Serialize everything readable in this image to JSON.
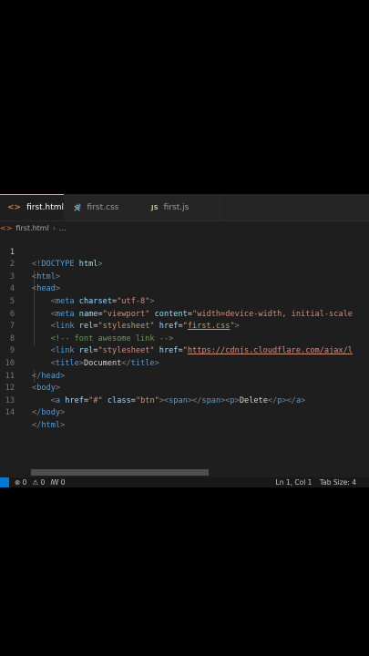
{
  "tabs": [
    {
      "icon": "<>",
      "label": "first.html",
      "active": true
    },
    {
      "icon": "#",
      "label": "first.css",
      "active": false
    },
    {
      "icon": "JS",
      "label": "first.js",
      "active": false
    }
  ],
  "breadcrumb": {
    "file": "first.html",
    "more": "..."
  },
  "line_numbers": [
    "1",
    "2",
    "3",
    "4",
    "5",
    "6",
    "7",
    "8",
    "9",
    "10",
    "11",
    "12",
    "13",
    "14"
  ],
  "code": {
    "l1_open": "<!",
    "l1_tag": "DOCTYPE",
    "l1_attr": "html",
    "l1_close": ">",
    "l2_tag": "html",
    "l3_tag": "head",
    "l4_tag": "meta",
    "l4_attr": "charset",
    "l4_val": "\"utf-8\"",
    "l5_tag": "meta",
    "l5_attr1": "name",
    "l5_val1": "\"viewport\"",
    "l5_attr2": "content",
    "l5_val2": "\"width=device-width, initial-scale",
    "l6_tag": "link",
    "l6_attr1": "rel",
    "l6_val1": "\"stylesheet\"",
    "l6_attr2": "href",
    "l6_val2a": "\"",
    "l6_val2b": "first.css",
    "l6_val2c": "\"",
    "l7_comment": "<!-- font awesome link -->",
    "l8_tag": "link",
    "l8_attr1": "rel",
    "l8_val1": "\"stylesheet\"",
    "l8_attr2": "href",
    "l8_val2a": "\"",
    "l8_val2b": "https://cdnjs.cloudflare.com/ajax/l",
    "l9_tag": "title",
    "l9_text": "Document",
    "l10_tag": "head",
    "l11_tag": "body",
    "l12_tag": "a",
    "l12_attr1": "href",
    "l12_val1": "\"#\"",
    "l12_attr2": "class",
    "l12_val2": "\"btn\"",
    "l12_span": "span",
    "l12_p": "p",
    "l12_text": "Delete",
    "l13_tag": "body",
    "l14_tag": "html"
  },
  "status": {
    "errors": "⊗ 0",
    "warnings": "⚠ 0",
    "ports": "ꟿ 0",
    "position": "Ln 1, Col 1",
    "tabsize": "Tab Size: 4"
  },
  "colors": {
    "tag": "#569cd6",
    "attr": "#9cdcfe",
    "string": "#ce9178",
    "comment": "#6a9955",
    "active_tab_border": "#e8ab53"
  }
}
